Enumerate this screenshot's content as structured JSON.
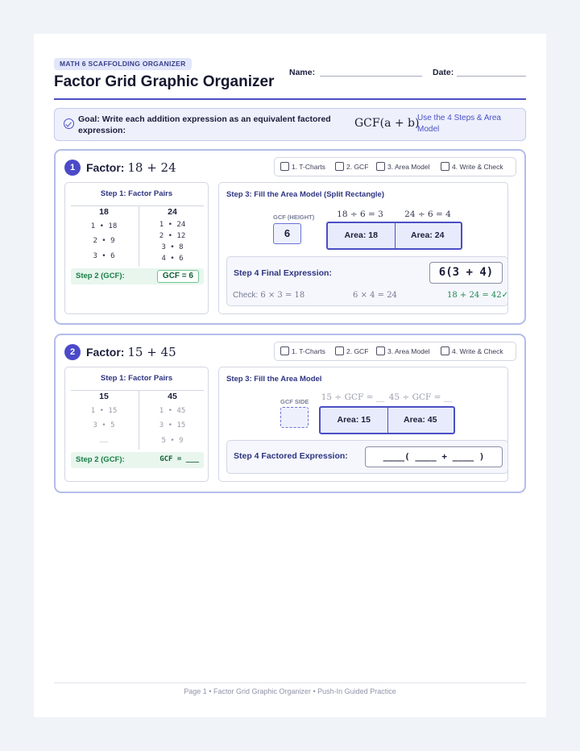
{
  "header": {
    "badge": "MATH 6 SCAFFOLDING ORGANIZER",
    "title": "Factor Grid Graphic Organizer",
    "name_label": "Name:",
    "date_label": "Date:"
  },
  "goal": {
    "icon": "check-circle-icon",
    "text": "Goal: Write each addition expression as an equivalent factored expression:",
    "formula": "GCF(a + b)",
    "note": "Use the 4 Steps & Area Model"
  },
  "steps_checklist": [
    "1. T-Charts",
    "2. GCF",
    "3. Area Model",
    "4. Write & Check"
  ],
  "problems": [
    {
      "number": "1",
      "label": "Factor:",
      "expression": "18 + 24",
      "pairs_title": "Step 1: Factor Pairs",
      "col_a": "18",
      "col_b": "24",
      "pairs_a": [
        "1 • 18",
        "2 • 9",
        "3 • 6"
      ],
      "pairs_b": [
        "1 • 24",
        "2 • 12",
        "3 • 8",
        "4 • 6"
      ],
      "gcf_label": "Step 2 (GCF):",
      "gcf_answer": "GCF = 6",
      "area_title": "Step 3: Fill the Area Model (Split Rectangle)",
      "gcf_side_label": "GCF (HEIGHT)",
      "gcf_value": "6",
      "div_a": "18 ÷ 6 = 3",
      "div_b": "24 ÷ 6 = 4",
      "area_a": "Area: 18",
      "area_b": "Area: 24",
      "final_label": "Step 4 Final Expression:",
      "final_expr": "6(3 + 4)",
      "check_prefix": "Check:",
      "check_a": "6 × 3 = 18",
      "check_b": "6 × 4 = 24",
      "check_total": "18 + 24 = 42✓"
    },
    {
      "number": "2",
      "label": "Factor:",
      "expression": "15 + 45",
      "pairs_title": "Step 1: Factor Pairs",
      "col_a": "15",
      "col_b": "45",
      "pairs_a": [
        "1 • 15",
        "3 • 5",
        "__"
      ],
      "pairs_b": [
        "1 • 45",
        "3 • 15",
        "5 • 9"
      ],
      "gcf_label": "Step 2 (GCF):",
      "gcf_answer": "GCF  =  ___",
      "area_title": "Step 3: Fill the Area Model",
      "gcf_side_label": "GCF SIDE",
      "div_a": "15 ÷ GCF = __",
      "div_b": "45 ÷ GCF = __",
      "area_a": "Area: 15",
      "area_b": "Area: 45",
      "final_label": "Step 4 Factored Expression:",
      "final_expr": "____(  ____  +  ____  )"
    }
  ],
  "footer": "Page 1 • Factor Grid Graphic Organizer • Push-In Guided Practice"
}
